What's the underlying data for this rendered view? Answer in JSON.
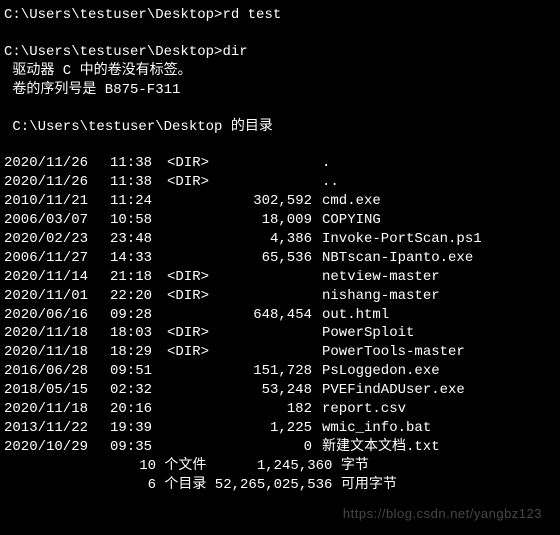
{
  "prompt1": {
    "path": "C:\\Users\\testuser\\Desktop>",
    "cmd": "rd test"
  },
  "prompt2": {
    "path": "C:\\Users\\testuser\\Desktop>",
    "cmd": "dir"
  },
  "volume_line": " 驱动器 C 中的卷没有标签。",
  "serial_line": " 卷的序列号是 B875-F311",
  "dir_of_line": " C:\\Users\\testuser\\Desktop 的目录",
  "rows": [
    {
      "date": "2020/11/26",
      "time": "11:38",
      "dir": "<DIR>",
      "size": "",
      "name": "."
    },
    {
      "date": "2020/11/26",
      "time": "11:38",
      "dir": "<DIR>",
      "size": "",
      "name": ".."
    },
    {
      "date": "2010/11/21",
      "time": "11:24",
      "dir": "",
      "size": "302,592",
      "name": "cmd.exe"
    },
    {
      "date": "2006/03/07",
      "time": "10:58",
      "dir": "",
      "size": "18,009",
      "name": "COPYING"
    },
    {
      "date": "2020/02/23",
      "time": "23:48",
      "dir": "",
      "size": "4,386",
      "name": "Invoke-PortScan.ps1"
    },
    {
      "date": "2006/11/27",
      "time": "14:33",
      "dir": "",
      "size": "65,536",
      "name": "NBTscan-Ipanto.exe"
    },
    {
      "date": "2020/11/14",
      "time": "21:18",
      "dir": "<DIR>",
      "size": "",
      "name": "netview-master"
    },
    {
      "date": "2020/11/01",
      "time": "22:20",
      "dir": "<DIR>",
      "size": "",
      "name": "nishang-master"
    },
    {
      "date": "2020/06/16",
      "time": "09:28",
      "dir": "",
      "size": "648,454",
      "name": "out.html"
    },
    {
      "date": "2020/11/18",
      "time": "18:03",
      "dir": "<DIR>",
      "size": "",
      "name": "PowerSploit"
    },
    {
      "date": "2020/11/18",
      "time": "18:29",
      "dir": "<DIR>",
      "size": "",
      "name": "PowerTools-master"
    },
    {
      "date": "2016/06/28",
      "time": "09:51",
      "dir": "",
      "size": "151,728",
      "name": "PsLoggedon.exe"
    },
    {
      "date": "2018/05/15",
      "time": "02:32",
      "dir": "",
      "size": "53,248",
      "name": "PVEFindADUser.exe"
    },
    {
      "date": "2020/11/18",
      "time": "20:16",
      "dir": "",
      "size": "182",
      "name": "report.csv"
    },
    {
      "date": "2013/11/22",
      "time": "19:39",
      "dir": "",
      "size": "1,225",
      "name": "wmic_info.bat"
    },
    {
      "date": "2020/10/29",
      "time": "09:35",
      "dir": "",
      "size": "0",
      "name": "新建文本文档.txt"
    }
  ],
  "summary_files": "   10 个文件      1,245,360 字节",
  "summary_dirs": "    6 个目录 52,265,025,536 可用字节",
  "watermark": "https://blog.csdn.net/yangbz123"
}
